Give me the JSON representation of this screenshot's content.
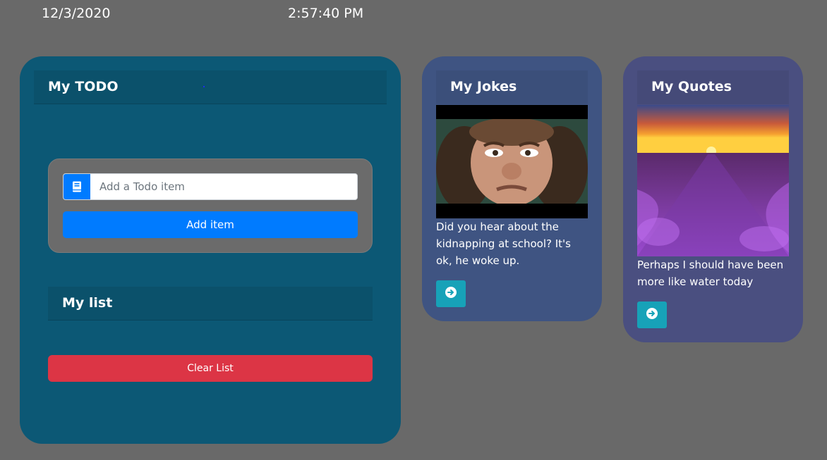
{
  "header": {
    "date": "12/3/2020",
    "time": "2:57:40 PM"
  },
  "todo": {
    "title": "My TODO",
    "input_placeholder": "Add a Todo item",
    "input_icon": "book-icon",
    "add_button_label": "Add item",
    "list_title": "My list",
    "clear_button_label": "Clear List"
  },
  "jokes": {
    "title": "My Jokes",
    "image_subject": "face-photo",
    "text": "Did you hear about the kidnapping at school? It's ok, he woke up.",
    "next_icon": "arrow-circle-right-icon"
  },
  "quotes": {
    "title": "My Quotes",
    "image_subject": "lavender-field-sunset",
    "text": "Perhaps I should have been more like water today",
    "next_icon": "arrow-circle-right-icon"
  },
  "colors": {
    "page_bg": "#696969",
    "todo_card": "#0c5875",
    "jokes_card": "#3f5482",
    "quotes_card": "#4a4f80",
    "primary": "#007bff",
    "danger": "#dc3545",
    "info": "#17a2b8"
  }
}
